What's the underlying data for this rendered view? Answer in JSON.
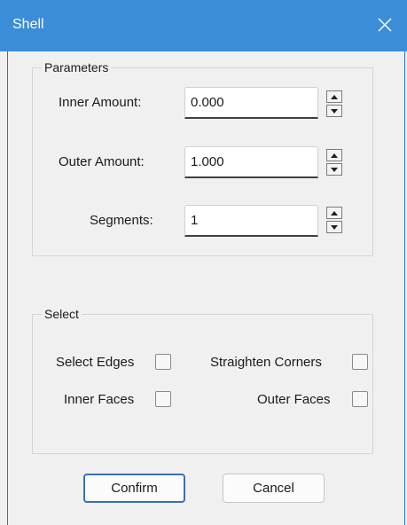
{
  "window": {
    "title": "Shell",
    "close_icon": "close-icon"
  },
  "parameters": {
    "legend": "Parameters",
    "inner_amount": {
      "label": "Inner Amount:",
      "value": "0.000"
    },
    "outer_amount": {
      "label": "Outer Amount:",
      "value": "1.000"
    },
    "segments": {
      "label": "Segments:",
      "value": "1"
    }
  },
  "select": {
    "legend": "Select",
    "select_edges": {
      "label": "Select Edges",
      "checked": false
    },
    "straighten_corners": {
      "label": "Straighten Corners",
      "checked": false
    },
    "inner_faces": {
      "label": "Inner Faces",
      "checked": false
    },
    "outer_faces": {
      "label": "Outer Faces",
      "checked": false
    }
  },
  "buttons": {
    "confirm": "Confirm",
    "cancel": "Cancel"
  },
  "colors": {
    "titlebar": "#3b8dd8",
    "default_button_border": "#3b6fb6"
  }
}
